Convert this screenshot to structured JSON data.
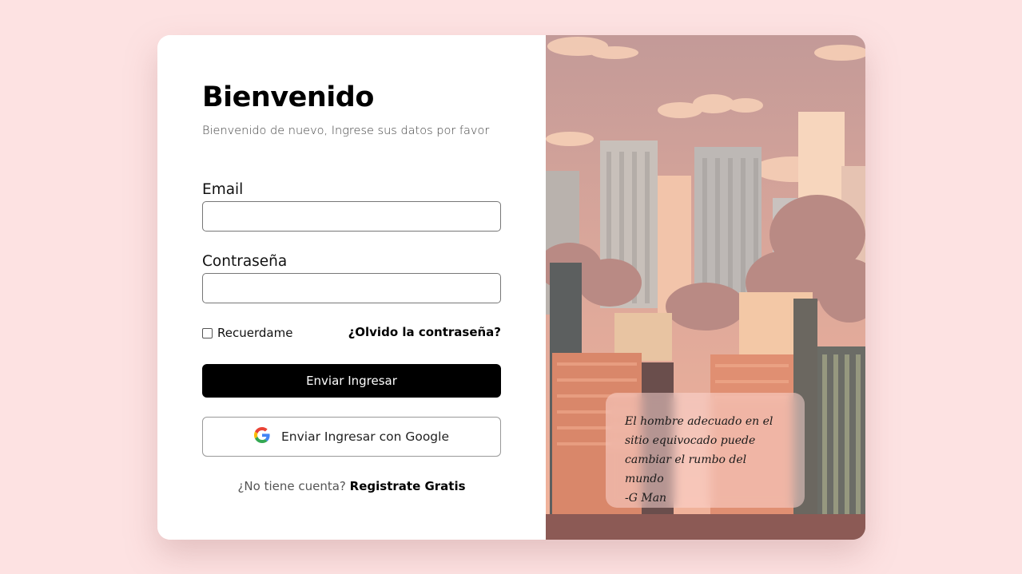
{
  "login": {
    "title": "Bienvenido",
    "subtitle": "Bienvenido de nuevo, Ingrese sus datos por favor",
    "email_label": "Email",
    "email_value": "",
    "password_label": "Contraseña",
    "password_value": "",
    "remember_label": "Recuerdame",
    "remember_checked": false,
    "forgot_link": "¿Olvido la contraseña?",
    "submit_label": "Enviar Ingresar",
    "google_label": "Enviar Ingresar con Google",
    "google_icon": "google-g-icon",
    "signup_prompt": "¿No tiene cuenta?",
    "signup_link": "Registrate Gratis"
  },
  "hero": {
    "illustration": "pixel-art-city-skyline",
    "quote_lines": [
      "El hombre adecuado en el",
      "sitio equivocado puede",
      "cambiar el rumbo del mundo",
      "-G Man"
    ]
  },
  "colors": {
    "page_background": "#fde2e2",
    "primary_button": "#000000",
    "sky_top": "#c9a29f",
    "sky_bottom": "#f2b6a0"
  }
}
